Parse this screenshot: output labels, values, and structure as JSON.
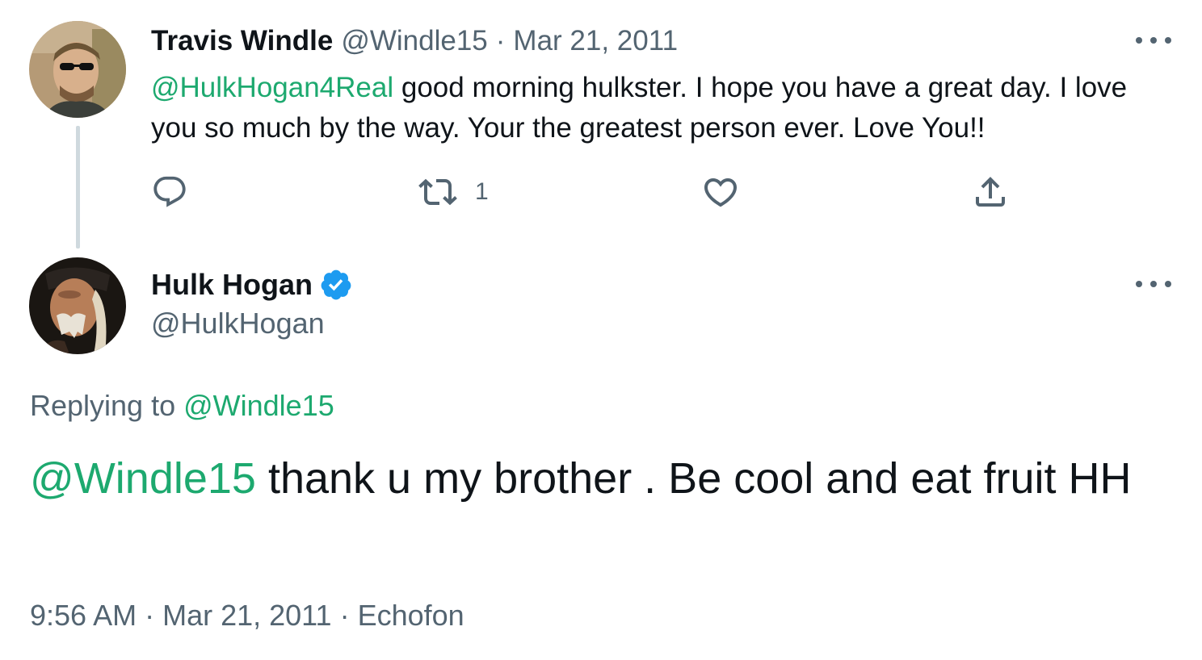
{
  "tweet_parent": {
    "author_name": "Travis Windle",
    "author_handle": "@Windle15",
    "separator": "·",
    "date": "Mar 21, 2011",
    "mention": "@HulkHogan4Real",
    "text": " good morning hulkster. I hope you have a great day. I love you so much by the way. Your the greatest person ever. Love You!!",
    "actions": {
      "reply_icon": "speech-bubble-icon",
      "retweet_icon": "retweet-arrows-icon",
      "retweet_count": "1",
      "like_icon": "heart-icon",
      "share_icon": "share-upload-icon"
    },
    "more_icon": "more-dots-icon"
  },
  "tweet_main": {
    "author_name": "Hulk Hogan",
    "verified_icon": "verified-badge-icon",
    "author_handle": "@HulkHogan",
    "replying_label": "Replying to ",
    "replying_mention": "@Windle15",
    "mention": "@Windle15",
    "text": " thank u my brother . Be cool and eat fruit HH",
    "time": "9:56 AM",
    "separator": "·",
    "date": "Mar 21, 2011",
    "source": "Echofon",
    "more_icon": "more-dots-icon"
  },
  "colors": {
    "mention": "#1da96f",
    "secondary_text": "#536471",
    "primary_text": "#0f1419",
    "verified": "#1d9bf0",
    "thread_line": "#cfd9de"
  }
}
